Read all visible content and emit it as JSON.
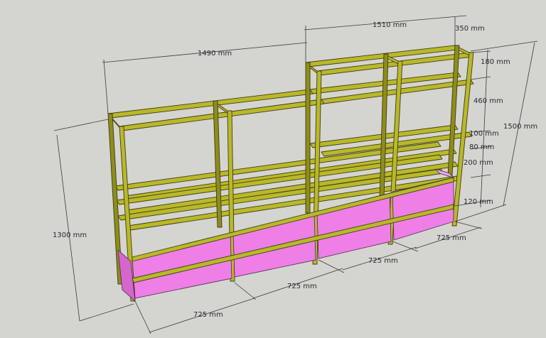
{
  "dimensions": {
    "top_width_left": "1490 mm",
    "top_width_right": "1510 mm",
    "top_depth": "350 mm",
    "left_height": "1300 mm",
    "right_height": "1500 mm",
    "r1": "180 mm",
    "r2": "460 mm",
    "r3": "100 mm",
    "r4": "80 mm",
    "r5": "200 mm",
    "r6": "120 mm",
    "b1": "725 mm",
    "b2": "725 mm",
    "b3": "725 mm",
    "b4": "725 mm"
  },
  "colors": {
    "background": "#d4d4d0",
    "frame": "#b9b82b",
    "panel": "#ee7fe6"
  }
}
